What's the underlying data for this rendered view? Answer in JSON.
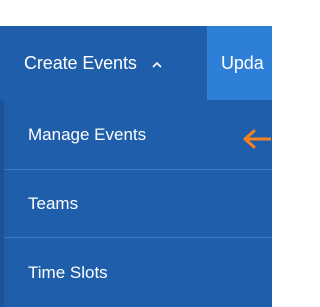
{
  "navbar": {
    "create_label": "Create Events",
    "update_label": "Upda"
  },
  "dropdown": {
    "items": [
      {
        "label": "Manage Events"
      },
      {
        "label": "Teams"
      },
      {
        "label": "Time Slots"
      }
    ]
  },
  "colors": {
    "nav_bg": "#1f5eab",
    "nav_active_bg": "#2d7fd7",
    "arrow": "#f5821f",
    "text": "#ffffff"
  },
  "icons": {
    "chevron": "chevron-up-icon",
    "pointer": "arrow-left-icon"
  }
}
